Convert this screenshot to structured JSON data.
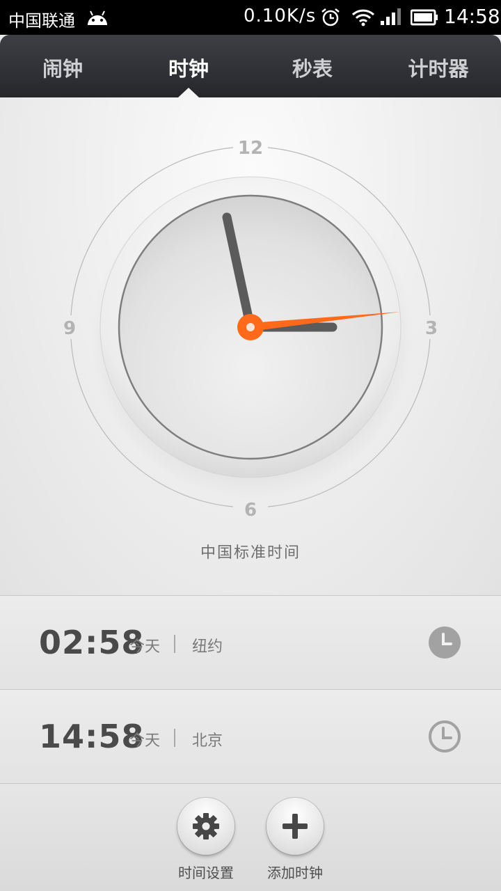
{
  "status_bar": {
    "carrier": "中国联通",
    "speed": "0.10K/s",
    "time": "14:58"
  },
  "tabs": [
    {
      "label": "闹钟",
      "active": false
    },
    {
      "label": "时钟",
      "active": true
    },
    {
      "label": "秒表",
      "active": false
    },
    {
      "label": "计时器",
      "active": false
    }
  ],
  "clock": {
    "numerals": {
      "top": "12",
      "right": "3",
      "bottom": "6",
      "left": "9"
    },
    "time_shown": "14:58",
    "timezone_label": "中国标准时间",
    "accent_color": "#ff6a1a"
  },
  "world_clocks": [
    {
      "time": "02:58",
      "day": "今天",
      "city": "纽约",
      "icon": "clock-night-icon"
    },
    {
      "time": "14:58",
      "day": "今天",
      "city": "北京",
      "icon": "clock-day-icon"
    }
  ],
  "bottom_bar": {
    "settings_label": "时间设置",
    "add_label": "添加时钟"
  }
}
